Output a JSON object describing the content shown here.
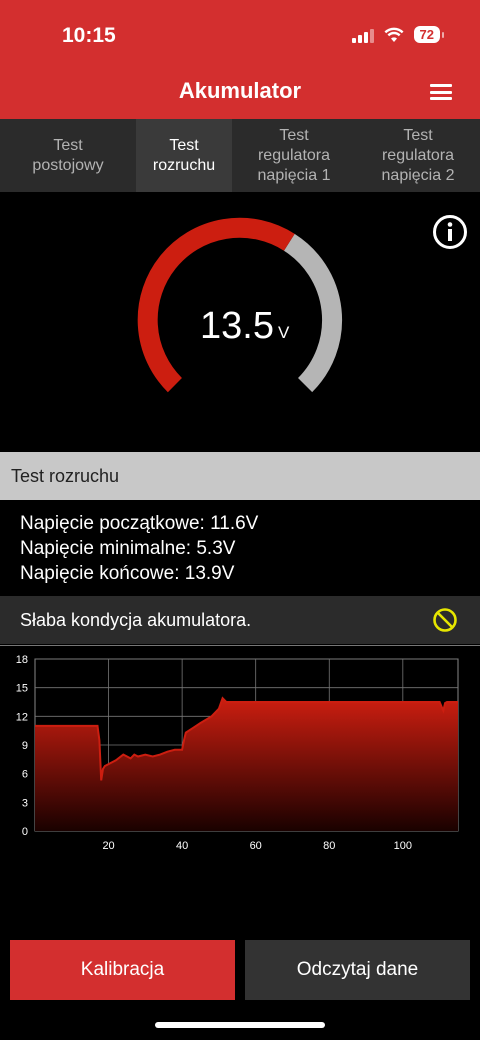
{
  "status_bar": {
    "time": "10:15",
    "battery": "72"
  },
  "header": {
    "title": "Akumulator"
  },
  "tabs": [
    {
      "label": "Test postojowy"
    },
    {
      "label": "Test rozruchu"
    },
    {
      "label": "Test regulatora napięcia 1"
    },
    {
      "label": "Test regulatora napięcia 2"
    }
  ],
  "gauge": {
    "value": "13.5",
    "unit": "V",
    "level_fraction": 0.62,
    "colors": {
      "fill": "#cc1e10",
      "track": "#b5b5b5"
    }
  },
  "section": {
    "title": "Test rozruchu"
  },
  "results": {
    "initial": "Napięcie początkowe: 11.6V",
    "minimal": "Napięcie minimalne: 5.3V",
    "final": "Napięcie końcowe: 13.9V"
  },
  "warning": {
    "text": "Słaba kondycja akumulatora.",
    "icon": "prohibited-icon",
    "color": "#e6e600"
  },
  "chart_data": {
    "type": "area",
    "title": "",
    "xlabel": "",
    "ylabel": "",
    "xlim": [
      0,
      115
    ],
    "ylim": [
      0,
      18
    ],
    "yticks": [
      "0",
      "3",
      "6",
      "9",
      "12",
      "15",
      "18"
    ],
    "xticks": [
      "20",
      "40",
      "60",
      "80",
      "100"
    ],
    "grid": true,
    "series": [
      {
        "color": "#cc1e10",
        "x": [
          0,
          16,
          17,
          17.5,
          18,
          18.5,
          19,
          22,
          24,
          26,
          27,
          28,
          30,
          32,
          34,
          36,
          38,
          40,
          40.5,
          41,
          43,
          45,
          48,
          50,
          51,
          52,
          54,
          60,
          70,
          80,
          90,
          100,
          110,
          111,
          111.5,
          112,
          115
        ],
        "y": [
          11.0,
          11.0,
          11.0,
          9.5,
          5.3,
          6.5,
          6.8,
          7.4,
          8.0,
          7.6,
          8.0,
          7.8,
          8.0,
          7.8,
          8.0,
          8.3,
          8.5,
          8.5,
          9.5,
          10.3,
          10.8,
          11.3,
          12.0,
          12.8,
          13.9,
          13.5,
          13.5,
          13.5,
          13.5,
          13.5,
          13.5,
          13.5,
          13.5,
          12.6,
          13.4,
          13.5,
          13.5
        ]
      }
    ]
  },
  "buttons": {
    "calibration": "Kalibracja",
    "read_data": "Odczytaj dane"
  }
}
